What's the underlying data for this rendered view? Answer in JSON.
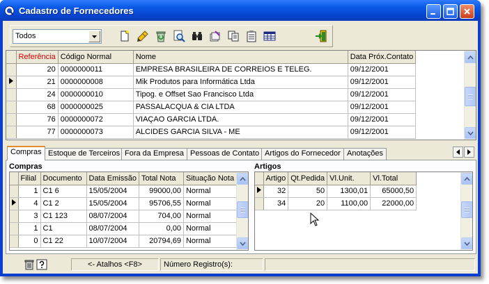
{
  "window": {
    "title": "Cadastro de Fornecedores"
  },
  "toolbar": {
    "filter": {
      "value": "Todos",
      "options": [
        "Todos"
      ]
    },
    "icons": [
      "new-document-icon",
      "edit-pencil-icon",
      "recycle-bin-icon",
      "magnifier-icon",
      "binoculars-icon",
      "paper-stack-icon",
      "copy-pages-icon",
      "clipboard-list-icon",
      "grid-table-icon",
      "exit-door-icon"
    ]
  },
  "suppliers": {
    "columns": [
      "Referência",
      "Código Normal",
      "Nome",
      "Data Próx.Contato"
    ],
    "rows": [
      {
        "ref": "20",
        "code": "0000000011",
        "name": "EMPRESA BRASILEIRA DE CORREIOS E TELEG.",
        "date": "09/12/2001"
      },
      {
        "ref": "21",
        "code": "0000000008",
        "name": "Mik Produtos para Informática Ltda",
        "date": "09/12/2001"
      },
      {
        "ref": "24",
        "code": "0000000010",
        "name": "Tipog. e Offset Sao Francisco Ltda",
        "date": "09/12/2001"
      },
      {
        "ref": "68",
        "code": "0000000025",
        "name": "PASSALACQUA & CIA LTDA",
        "date": "09/12/2001"
      },
      {
        "ref": "76",
        "code": "0000000072",
        "name": "VIAÇAO GARCIA LTDA.",
        "date": "09/12/2001"
      },
      {
        "ref": "77",
        "code": "0000000073",
        "name": "ALCIDES GARCIA SILVA - ME",
        "date": "09/12/2001"
      }
    ]
  },
  "tabs": [
    "Compras",
    "Estoque de Terceiros",
    "Fora da Empresa",
    "Pessoas de Contato",
    "Artigos do Fornecedor",
    "Anotações"
  ],
  "compras": {
    "title": "Compras",
    "columns": [
      "Filial",
      "Documento",
      "Data Emissão",
      "Total Nota",
      "Situação Nota"
    ],
    "rows": [
      {
        "filial": "1",
        "doc": "C1 6",
        "date": "15/05/2004",
        "total": "99000,00",
        "status": "Normal"
      },
      {
        "filial": "4",
        "doc": "C1 2",
        "date": "15/05/2004",
        "total": "95706,55",
        "status": "Normal"
      },
      {
        "filial": "3",
        "doc": "C1 123",
        "date": "08/07/2004",
        "total": "704,00",
        "status": "Normal"
      },
      {
        "filial": "1",
        "doc": "C1",
        "date": "08/07/2004",
        "total": "0,00",
        "status": "Normal"
      },
      {
        "filial": "0",
        "doc": "C1 22",
        "date": "10/07/2004",
        "total": "20794,69",
        "status": "Normal"
      }
    ]
  },
  "artigos": {
    "title": "Artigos",
    "columns": [
      "Artigo",
      "Qt.Pedida",
      "Vl.Unit.",
      "Vl.Total"
    ],
    "rows": [
      {
        "artigo": "32",
        "qt": "50",
        "unit": "1300,01",
        "total": "65000,50"
      },
      {
        "artigo": "34",
        "qt": "20",
        "unit": "1100,00",
        "total": "22000,00"
      }
    ]
  },
  "statusbar": {
    "shortcuts": "<- Atalhos <F8>",
    "records_label": "Número Registro(s):"
  },
  "colors": {
    "title_blue": "#0a5ae6",
    "header_red": "#d40000",
    "tab_accent": "#e68b2c"
  }
}
